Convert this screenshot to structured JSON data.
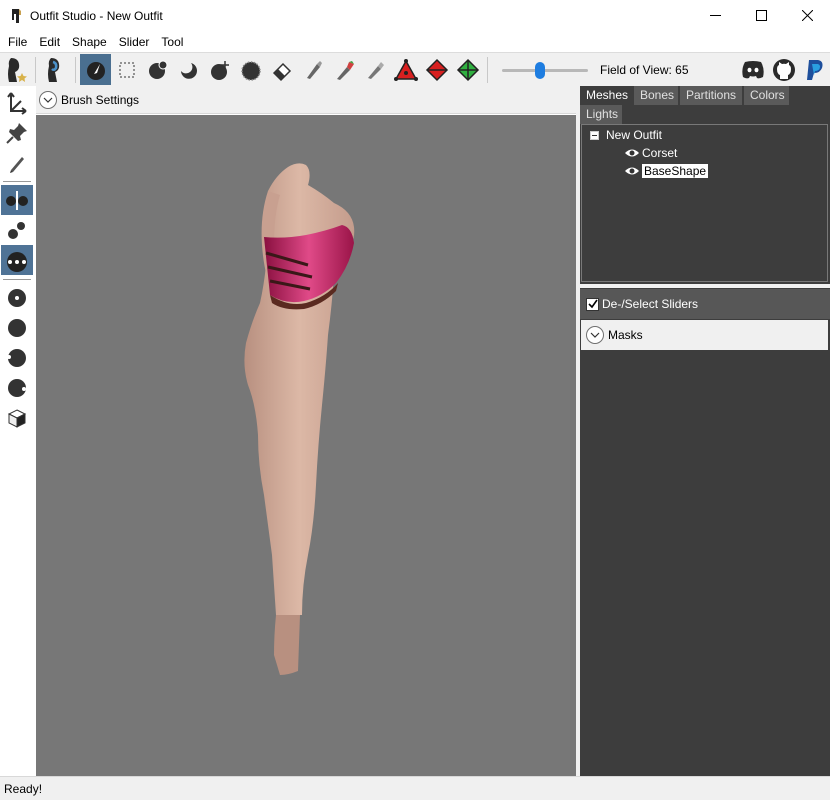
{
  "window": {
    "title": "Outfit Studio - New Outfit"
  },
  "menu": [
    "File",
    "Edit",
    "Shape",
    "Slider",
    "Tool"
  ],
  "toolbar": {
    "field_of_view_label": "Field of View: 65",
    "field_of_view_value": 65,
    "active_tool": "select-brush"
  },
  "brush_settings": {
    "label": "Brush Settings"
  },
  "tabs": [
    "Meshes",
    "Bones",
    "Partitions",
    "Colors",
    "Lights"
  ],
  "tree": {
    "root": "New Outfit",
    "items": [
      "Corset",
      "BaseShape"
    ],
    "selected": "BaseShape"
  },
  "sliders_toggle": {
    "label": "De-/Select Sliders",
    "checked": true
  },
  "masks": {
    "label": "Masks"
  },
  "status": {
    "text": "Ready!"
  },
  "colors": {
    "active_tool": "#4a6f90",
    "viewport": "#777777",
    "panel": "#3d3d3d",
    "accent": "#1e7de0"
  }
}
